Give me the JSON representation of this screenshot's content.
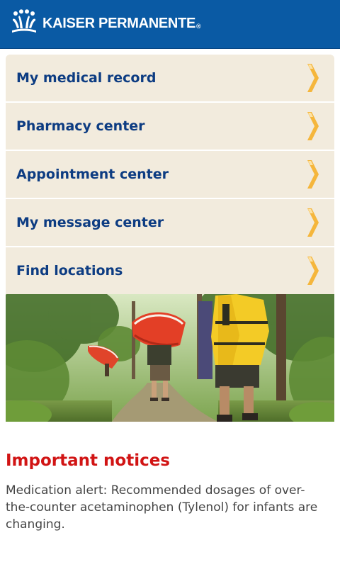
{
  "header": {
    "brand_name": "KAISER PERMANENTE",
    "registered_mark": "®",
    "logo_icon": "kaiser-permanente-logo-icon",
    "background_color": "#0a5aa4"
  },
  "menu": {
    "items": [
      {
        "label": "My medical record",
        "icon": "chevron-right-icon"
      },
      {
        "label": "Pharmacy center",
        "icon": "chevron-right-icon"
      },
      {
        "label": "Appointment center",
        "icon": "chevron-right-icon"
      },
      {
        "label": "My message center",
        "icon": "chevron-right-icon"
      },
      {
        "label": "Find locations",
        "icon": "chevron-right-icon"
      }
    ],
    "background_color": "#f2ebdd",
    "label_color": "#0d3c82",
    "chevron_color": "#f5b63c"
  },
  "hero_image": {
    "subject": "hikers carrying red canoes on a forest trail"
  },
  "notices": {
    "title": "Important notices",
    "title_color": "#d11414",
    "items": [
      {
        "text": "Medication alert: Recommended dosages of over-the-counter acetaminophen (Tylenol) for infants are changing."
      }
    ]
  }
}
